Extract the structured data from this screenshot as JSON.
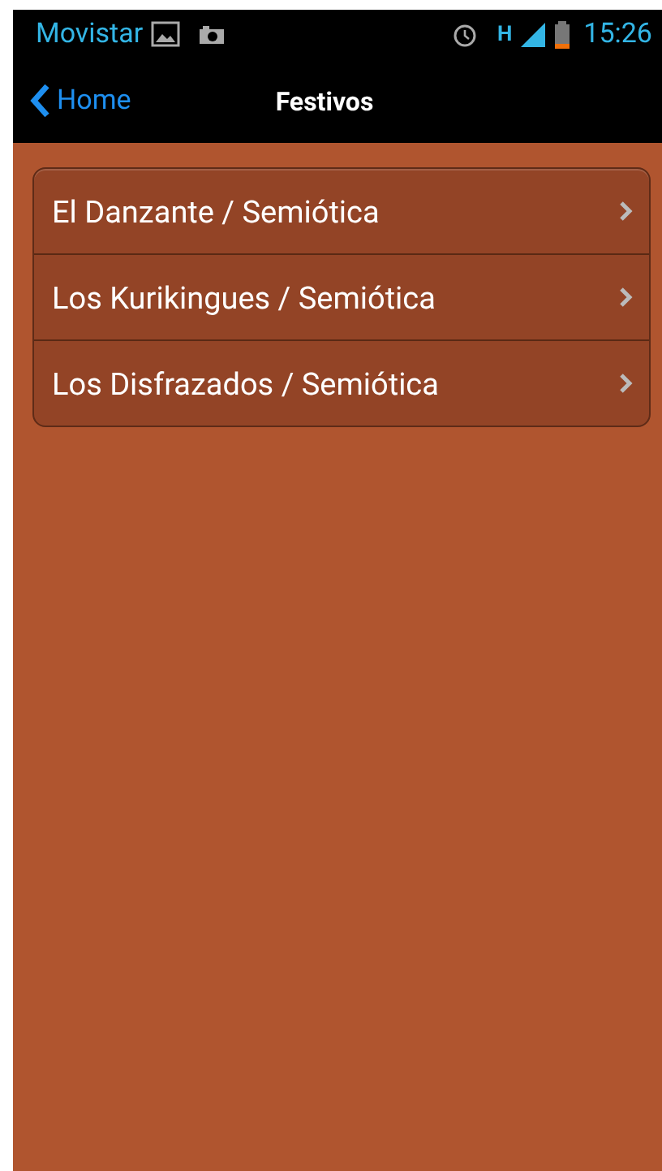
{
  "status_bar": {
    "carrier": "Movistar",
    "time": "15:26",
    "network": "H"
  },
  "nav_bar": {
    "back_label": "Home",
    "title": "Festivos"
  },
  "list": [
    {
      "label": "El Danzante / Semiótica"
    },
    {
      "label": "Los Kurikingues / Semiótica"
    },
    {
      "label": "Los Disfrazados / Semiótica"
    }
  ]
}
